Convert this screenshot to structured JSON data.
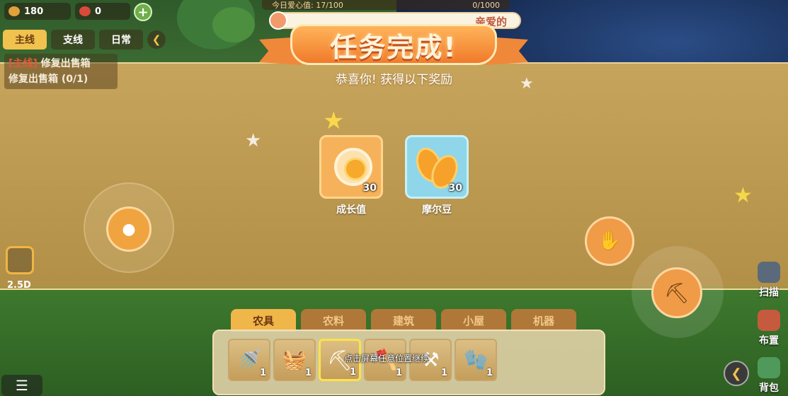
{
  "resources": [
    {
      "name": "gold",
      "value": "180",
      "color": "#e0a23a"
    },
    {
      "name": "beans",
      "value": "0",
      "color": "#d94a3a"
    }
  ],
  "quest_panel": {
    "tabs": [
      "主线",
      "支线",
      "日常"
    ],
    "active_tab": "主线",
    "quest_tag": "[主线]",
    "quest_name": "修复出售箱",
    "quest_progress": "修复出售箱 (0/1)"
  },
  "love_bar": {
    "left": "今日爱心值: 17/100",
    "right": "0/1000"
  },
  "progress": {
    "label": "亲爱的",
    "fill_fraction": 0.02
  },
  "banner": {
    "title": "任务完成!",
    "subtitle": "恭喜你! 获得以下奖励"
  },
  "rewards": [
    {
      "name": "成长值",
      "qty": "30",
      "icon": "growth-coin-icon",
      "bg": "#f6b25a"
    },
    {
      "name": "摩尔豆",
      "qty": "30",
      "icon": "mole-bean-icon",
      "bg": "#8fd6ea"
    }
  ],
  "camera": {
    "label": "2.5D"
  },
  "side_menu": [
    {
      "label": "扫描",
      "icon": "scan-icon"
    },
    {
      "label": "布置",
      "icon": "decorate-icon"
    },
    {
      "label": "背包",
      "icon": "backpack-icon"
    }
  ],
  "toolbar": {
    "tabs": [
      "农具",
      "农料",
      "建筑",
      "小屋",
      "机器"
    ],
    "active_tab": "农具",
    "tools": [
      {
        "icon": "watering-can-icon",
        "glyph": "🚿",
        "count": "1"
      },
      {
        "icon": "basket-icon",
        "glyph": "🧺",
        "count": "1"
      },
      {
        "icon": "pickaxe-icon",
        "glyph": "⛏",
        "count": "1",
        "selected": true
      },
      {
        "icon": "axe-icon",
        "glyph": "🪓",
        "count": "1"
      },
      {
        "icon": "hoe-icon",
        "glyph": "⚒",
        "count": "1"
      },
      {
        "icon": "glove-icon",
        "glyph": "🧤",
        "count": "1"
      }
    ],
    "hint": "点击屏幕任意位置继续"
  },
  "colors": {
    "accent": "#f1c24e",
    "ribbon": "#f07a2a",
    "overlay": "#e1b969"
  }
}
